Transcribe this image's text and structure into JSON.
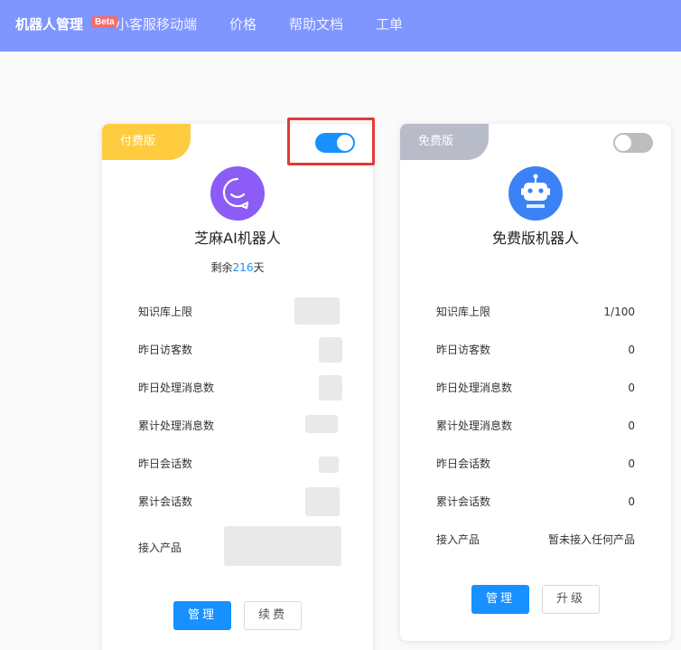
{
  "nav": {
    "items": [
      {
        "label": "机器人管理",
        "active": true
      },
      {
        "label": "小客服移动端",
        "active": false
      },
      {
        "label": "价格",
        "active": false
      },
      {
        "label": "帮助文档",
        "active": false
      },
      {
        "label": "工单",
        "active": false
      }
    ],
    "beta_badge": "Beta"
  },
  "paid_card": {
    "tier": "付费版",
    "toggle_on": true,
    "name": "芝麻AI机器人",
    "remain_prefix": "剩余",
    "remain_days": "216",
    "remain_suffix": "天",
    "stats": [
      {
        "label": "知识库上限"
      },
      {
        "label": "昨日访客数"
      },
      {
        "label": "昨日处理消息数"
      },
      {
        "label": "累计处理消息数"
      },
      {
        "label": "昨日会话数"
      },
      {
        "label": "累计会话数"
      },
      {
        "label": "接入产品"
      }
    ],
    "manage_button": "管理",
    "renew_button": "续费"
  },
  "free_card": {
    "tier": "免费版",
    "toggle_on": false,
    "name": "免费版机器人",
    "stats": [
      {
        "label": "知识库上限",
        "value": "1/100"
      },
      {
        "label": "昨日访客数",
        "value": "0"
      },
      {
        "label": "昨日处理消息数",
        "value": "0"
      },
      {
        "label": "累计处理消息数",
        "value": "0"
      },
      {
        "label": "昨日会话数",
        "value": "0"
      },
      {
        "label": "累计会话数",
        "value": "0"
      },
      {
        "label": "接入产品",
        "value": "暂未接入任何产品"
      }
    ],
    "manage_button": "管理",
    "upgrade_button": "升级"
  },
  "colors": {
    "nav_bg": "#7f96ff",
    "primary": "#1890ff",
    "paid_tag": "#ffcc3f",
    "free_tag": "#b8bcc9",
    "highlight": "#e53935"
  }
}
